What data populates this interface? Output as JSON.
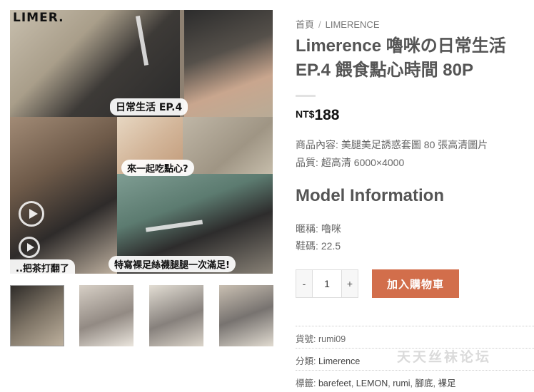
{
  "gallery": {
    "brand_logo": "LIMER.",
    "overlay_title": "日常生活 EP.4",
    "overlay_snack": "來一起吃點心?",
    "overlay_tea": "..把茶打翻了",
    "overlay_caption": "特寫裸足絲襪腿腿一次滿足!",
    "thumbnail_count": 4
  },
  "breadcrumb": {
    "home": "首頁",
    "separator": "/",
    "category": "LIMERENCE"
  },
  "product": {
    "title": "Limerence 嚕咪の日常生活 EP.4 餵食點心時間 80P",
    "currency": "NT$",
    "price": "188",
    "content_label": "商品內容:",
    "content_value": "美腿美足誘惑套圖 80 張高清圖片",
    "quality_label": "品質:",
    "quality_value": "超高清 6000×4000"
  },
  "model_info": {
    "heading": "Model Information",
    "nickname_label": "暱稱:",
    "nickname_value": "嚕咪",
    "shoe_label": "鞋碼:",
    "shoe_value": "22.5"
  },
  "purchase": {
    "minus_label": "-",
    "quantity": "1",
    "plus_label": "+",
    "add_to_cart_label": "加入購物車"
  },
  "meta": {
    "sku_label": "貨號:",
    "sku_value": "rumi09",
    "category_label": "分類:",
    "category_value": "Limerence",
    "tags_label": "標籤:",
    "tags": [
      "barefeet",
      "LEMON",
      "rumi",
      "腳底",
      "裸足"
    ]
  },
  "watermark": "天天丝袜论坛",
  "colors": {
    "accent_button": "#d26e4b",
    "heading_text": "#555555",
    "price_text": "#111111"
  }
}
